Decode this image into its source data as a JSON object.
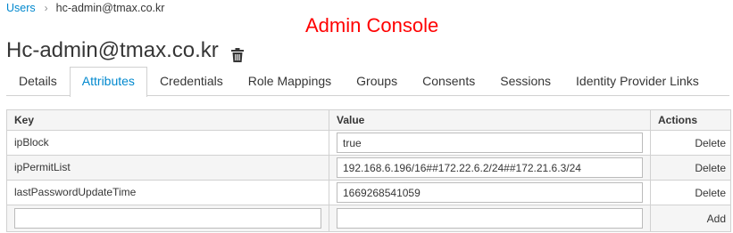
{
  "breadcrumb": {
    "users_label": "Users",
    "separator": "›",
    "current": "hc-admin@tmax.co.kr"
  },
  "console_title": "Admin Console",
  "page_title": "Hc-admin@tmax.co.kr",
  "tabs": [
    {
      "label": "Details",
      "active": false
    },
    {
      "label": "Attributes",
      "active": true
    },
    {
      "label": "Credentials",
      "active": false
    },
    {
      "label": "Role Mappings",
      "active": false
    },
    {
      "label": "Groups",
      "active": false
    },
    {
      "label": "Consents",
      "active": false
    },
    {
      "label": "Sessions",
      "active": false
    },
    {
      "label": "Identity Provider Links",
      "active": false
    }
  ],
  "table": {
    "headers": {
      "key": "Key",
      "value": "Value",
      "actions": "Actions"
    },
    "rows": [
      {
        "key": "ipBlock",
        "value": "true",
        "action": "Delete"
      },
      {
        "key": "ipPermitList",
        "value": "192.168.6.196/16##172.22.6.2/24##172.21.6.3/24",
        "action": "Delete"
      },
      {
        "key": "lastPasswordUpdateTime",
        "value": "1669268541059",
        "action": "Delete"
      }
    ],
    "new_row": {
      "key_value": "",
      "value_value": "",
      "action": "Add"
    }
  },
  "colors": {
    "accent": "#0088ce",
    "title_red": "#ff0000",
    "border": "#d1d1d1",
    "row_alt": "#f5f5f5"
  },
  "icons": {
    "delete_user": "trash-icon",
    "breadcrumb_sep": "chevron-right-icon"
  }
}
